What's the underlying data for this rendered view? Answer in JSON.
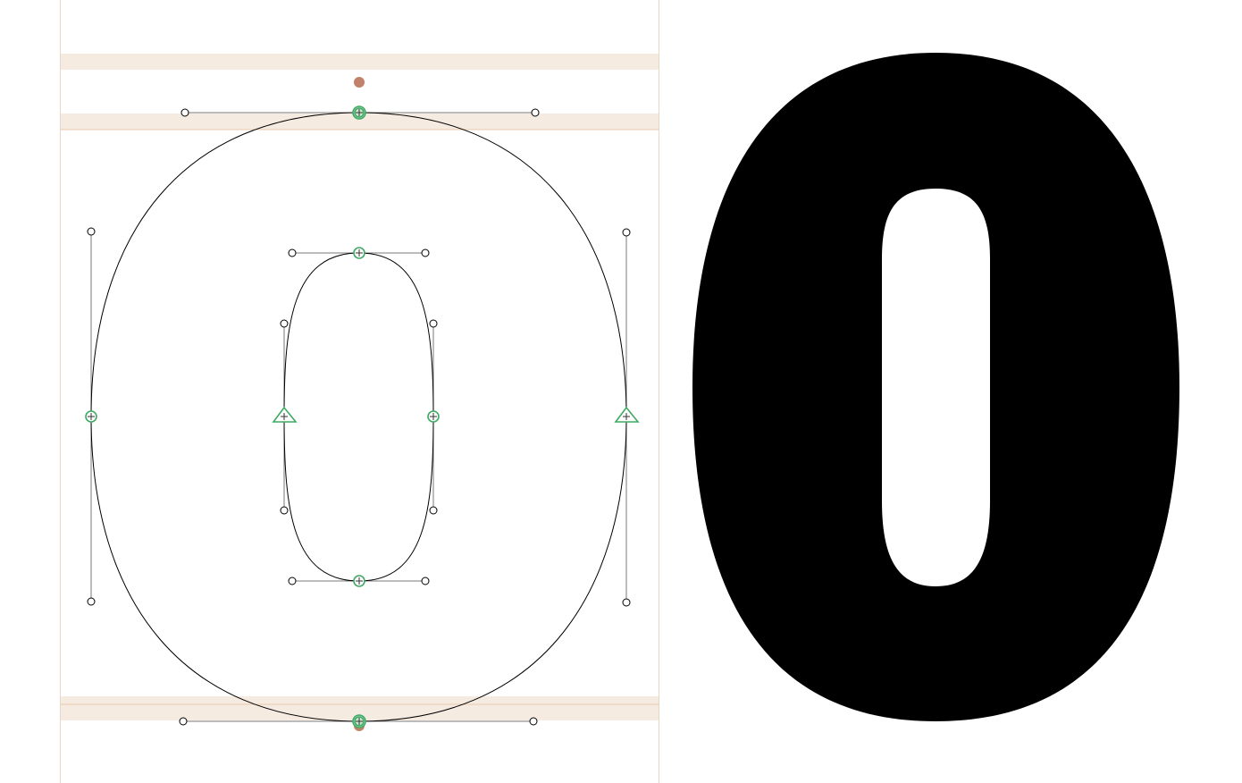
{
  "editor": {
    "glyph_name": "zero",
    "glyph_character": "0",
    "colors": {
      "canvas": "#ffffff",
      "metric_zone": "#f5ebe1",
      "metric_line": "#e8c9ad",
      "sidebearing": "#e8d5c4",
      "outline": "#000000",
      "handle_line": "#7a7a7a",
      "on_curve_point": "#3faa63",
      "start_point_fill": "#c9e6cf",
      "anchor": "#c0826a",
      "preview_fill": "#000000"
    },
    "tools": {
      "on_curve_point_icon": "green-circle-point-icon",
      "tangent_point_icon": "green-triangle-point-icon",
      "off_curve_handle_icon": "hollow-circle-handle-icon",
      "anchor_icon": "brown-dot-anchor-icon"
    }
  }
}
